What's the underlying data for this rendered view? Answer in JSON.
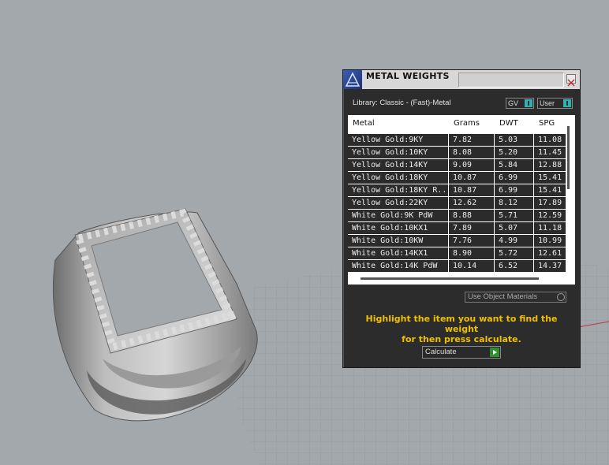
{
  "panel": {
    "title": "METAL WEIGHTS",
    "library_label": "Library: Classic - (Fast)-Metal",
    "gv_toggle_label": "GV",
    "user_toggle_label": "User",
    "use_object_materials_label": "Use Object Materials",
    "hint_line1": "Highlight the item you want to find the weight",
    "hint_line2": "for then press calculate.",
    "calculate_label": "Calculate"
  },
  "table": {
    "columns": [
      "Metal",
      "Grams",
      "DWT",
      "SPG"
    ],
    "rows": [
      [
        "Yellow Gold:9KY",
        "7.82",
        "5.03",
        "11.08"
      ],
      [
        "Yellow Gold:10KY",
        "8.08",
        "5.20",
        "11.45"
      ],
      [
        "Yellow Gold:14KY",
        "9.09",
        "5.84",
        "12.88"
      ],
      [
        "Yellow Gold:18KY",
        "10.87",
        "6.99",
        "15.41"
      ],
      [
        "Yellow Gold:18KY R...",
        "10.87",
        "6.99",
        "15.41"
      ],
      [
        "Yellow Gold:22KY",
        "12.62",
        "8.12",
        "17.89"
      ],
      [
        "White Gold:9K PdW",
        "8.88",
        "5.71",
        "12.59"
      ],
      [
        "White Gold:10KX1",
        "7.89",
        "5.07",
        "11.18"
      ],
      [
        "White Gold:10KW",
        "7.76",
        "4.99",
        "10.99"
      ],
      [
        "White Gold:14KX1",
        "8.90",
        "5.72",
        "12.61"
      ],
      [
        "White Gold:14K PdW",
        "10.14",
        "6.52",
        "14.37"
      ]
    ]
  },
  "colors": {
    "hint": "#f0c000",
    "toggle_knob": "#33b0b0",
    "calculate_arrow": "#2f8f2f"
  },
  "icons": {
    "title": "metal-weights-logo-icon",
    "close": "close-icon",
    "calculate": "play-arrow-icon"
  }
}
